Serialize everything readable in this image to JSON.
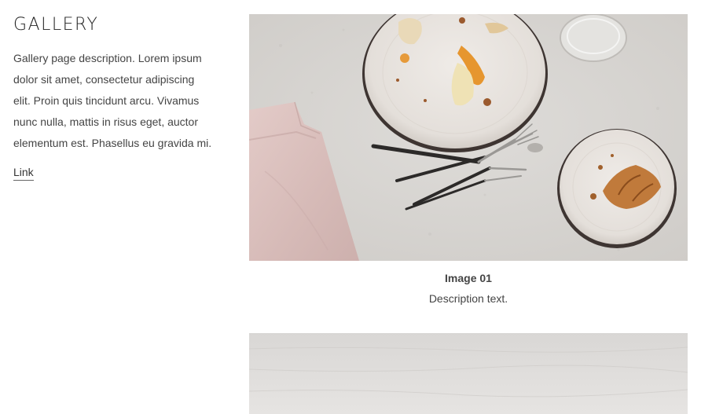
{
  "sidebar": {
    "title": "GALLERY",
    "description": "Gallery page description. Lorem ipsum dolor sit amet, consectetur adipiscing elit. Proin quis tincidunt arcu. Vivamus nunc nulla, mattis in risus eget, auctor elementum est. Phasellus eu gravida mi.",
    "link_label": "Link"
  },
  "gallery": {
    "items": [
      {
        "title": "Image 01",
        "description": "Description text."
      }
    ]
  },
  "colors": {
    "background": "#ffffff",
    "text": "#444444",
    "tabletop": "#d8d6d3",
    "linen": "#dcc3c1",
    "plate": "#ebe7e3",
    "plate_rim": "#4a3f3a",
    "cutlery": "#2c2a29",
    "orange_peel": "#e69a3a"
  }
}
